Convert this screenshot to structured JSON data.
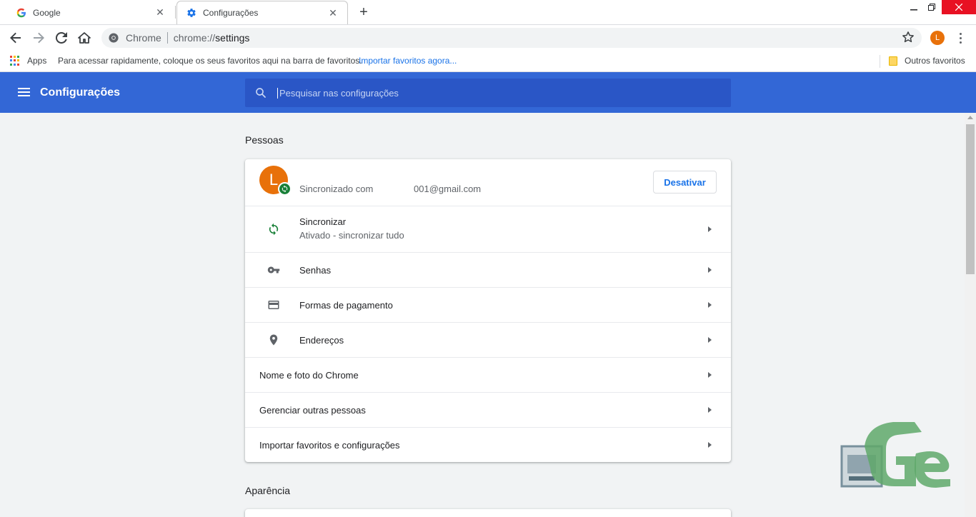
{
  "browser": {
    "tabs": [
      {
        "title": "Google",
        "favicon": "google-g-icon"
      },
      {
        "title": "Configurações",
        "favicon": "settings-gear-icon",
        "active": true
      }
    ],
    "omnibox": {
      "chip": "Chrome",
      "url_scheme": "chrome://",
      "url_path": "settings"
    },
    "profile_initial": "L",
    "bookmarks": {
      "apps_label": "Apps",
      "hint": "Para acessar rapidamente, coloque os seus favoritos aqui na barra de favoritos.",
      "import_link": "Importar favoritos agora...",
      "other_label": "Outros favoritos"
    }
  },
  "settings": {
    "title": "Configurações",
    "search_placeholder": "Pesquisar nas configurações",
    "people": {
      "section_title": "Pessoas",
      "avatar_initial": "L",
      "synced_with": "Sincronizado com",
      "email": "001@gmail.com",
      "turn_off_label": "Desativar",
      "rows": [
        {
          "label": "Sincronizar",
          "sublabel": "Ativado - sincronizar tudo",
          "icon": "sync-icon"
        },
        {
          "label": "Senhas",
          "icon": "key-icon"
        },
        {
          "label": "Formas de pagamento",
          "icon": "credit-card-icon"
        },
        {
          "label": "Endereços",
          "icon": "location-pin-icon"
        },
        {
          "label": "Nome e foto do Chrome"
        },
        {
          "label": "Gerenciar outras pessoas"
        },
        {
          "label": "Importar favoritos e configurações"
        }
      ]
    },
    "appearance": {
      "section_title": "Aparência"
    }
  },
  "colors": {
    "header_blue": "#3367d6",
    "search_blue": "#2a56c6",
    "profile_orange": "#e8710a",
    "sync_green": "#188038",
    "link_blue": "#1a73e8"
  }
}
